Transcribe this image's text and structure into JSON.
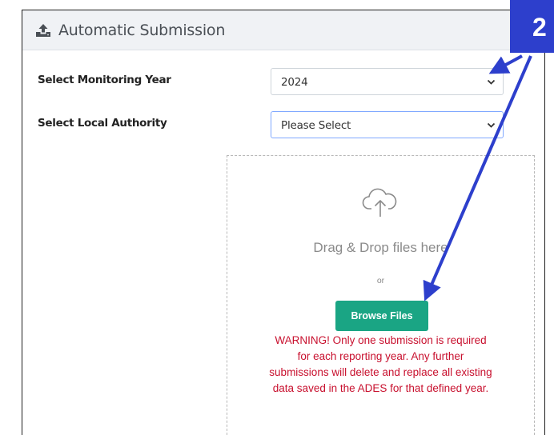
{
  "panel": {
    "title": "Automatic Submission",
    "header_icon": "upload-tray-icon"
  },
  "form": {
    "monitoring_year_label": "Select Monitoring Year",
    "monitoring_year_value": "2024",
    "local_authority_label": "Select Local Authority",
    "local_authority_value": "Please Select"
  },
  "dropzone": {
    "icon": "cloud-upload-icon",
    "drag_text": "Drag & Drop files here",
    "or_text": "or",
    "browse_label": "Browse Files",
    "warning_lines": [
      "WARNING! Only one submission is required",
      "for each reporting year. Any further",
      "submissions will delete and replace all existing",
      "data saved in the ADES for that defined year."
    ]
  },
  "annotation": {
    "step_number": "2"
  },
  "colors": {
    "header_bg": "#f0f2f5",
    "button_bg": "#1aa584",
    "warning_text": "#c8102e",
    "annotation_blue": "#2d3fcc"
  }
}
